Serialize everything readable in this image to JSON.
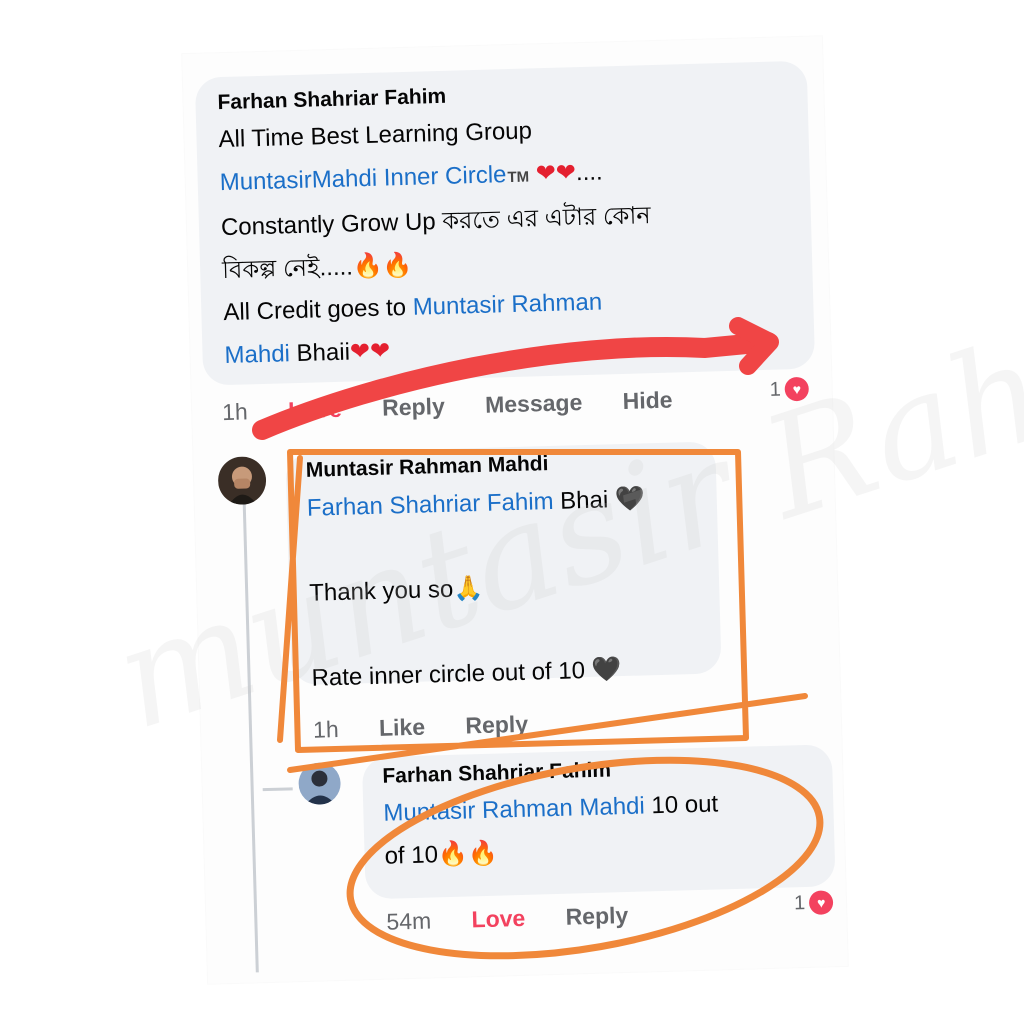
{
  "comment1": {
    "author": "Farhan Shahriar Fahim",
    "line1": "All Time Best Learning Group",
    "mention1": "MuntasirMahdi Inner Circle",
    "tm": "TM",
    "hearts1": "❤❤",
    "dots1": "....",
    "line3": "Constantly Grow Up করতে এর এটার কোন",
    "line4": "বিকল্প নেই.....",
    "fire1": "🔥🔥",
    "line5_prefix": "All Credit goes to",
    "mention2_a": "Muntasir Rahman",
    "mention2_b": "Mahdi",
    "line6_suffix": "Bhaii",
    "hearts2": "❤❤",
    "actions": {
      "time": "1h",
      "love": "Love",
      "reply": "Reply",
      "message": "Message",
      "hide": "Hide"
    },
    "reaction_count": "1"
  },
  "comment2": {
    "author": "Muntasir Rahman Mahdi",
    "mention": "Farhan Shahriar Fahim",
    "text1": "Bhai",
    "heart1": "🖤",
    "text2": "Thank you so",
    "pray": "🙏",
    "text3": "Rate inner circle out of 10",
    "heart2": "🖤",
    "actions": {
      "time": "1h",
      "like": "Like",
      "reply": "Reply"
    }
  },
  "comment3": {
    "author": "Farhan Shahriar Fahim",
    "mention": "Muntasir Rahman Mahdi",
    "text1": "10 out",
    "text2": "of 10",
    "fire": "🔥🔥",
    "actions": {
      "time": "54m",
      "love": "Love",
      "reply": "Reply"
    },
    "reaction_count": "1"
  },
  "watermark": "muntasir Rahman Mahdi",
  "colors": {
    "annotation_red": "#f04545",
    "annotation_orange": "#f0883a",
    "mention_blue": "#1b6fc8",
    "love_red": "#f3425f"
  }
}
